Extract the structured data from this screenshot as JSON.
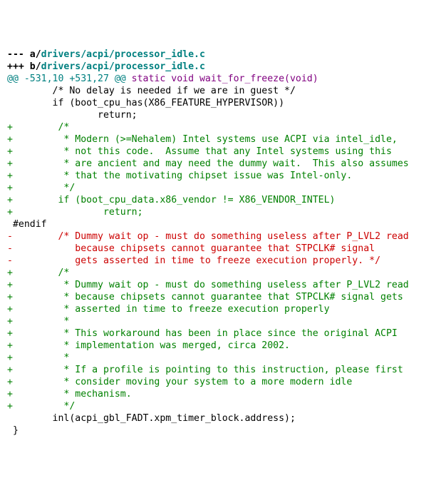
{
  "diff": {
    "file_a_prefix": "--- a/",
    "file_b_prefix": "+++ b/",
    "file_path": "drivers/acpi/processor_idle.c",
    "hunk_header_left": "@@ -531,10 +531,27 @@",
    "hunk_header_right": " static void wait_for_freeze(void)",
    "lines": [
      {
        "type": "ctx",
        "text": "        /* No delay is needed if we are in guest */"
      },
      {
        "type": "ctx",
        "text": "        if (boot_cpu_has(X86_FEATURE_HYPERVISOR))"
      },
      {
        "type": "ctx",
        "text": "                return;"
      },
      {
        "type": "add",
        "text": "+        /*"
      },
      {
        "type": "add",
        "text": "+         * Modern (>=Nehalem) Intel systems use ACPI via intel_idle,"
      },
      {
        "type": "add",
        "text": "+         * not this code.  Assume that any Intel systems using this"
      },
      {
        "type": "add",
        "text": "+         * are ancient and may need the dummy wait.  This also assumes"
      },
      {
        "type": "add",
        "text": "+         * that the motivating chipset issue was Intel-only."
      },
      {
        "type": "add",
        "text": "+         */"
      },
      {
        "type": "add",
        "text": "+        if (boot_cpu_data.x86_vendor != X86_VENDOR_INTEL)"
      },
      {
        "type": "add",
        "text": "+                return;"
      },
      {
        "type": "ctx",
        "text": " #endif"
      },
      {
        "type": "del",
        "text": "-        /* Dummy wait op - must do something useless after P_LVL2 read"
      },
      {
        "type": "del",
        "text": "-           because chipsets cannot guarantee that STPCLK# signal"
      },
      {
        "type": "del",
        "text": "-           gets asserted in time to freeze execution properly. */"
      },
      {
        "type": "add",
        "text": "+        /*"
      },
      {
        "type": "add",
        "text": "+         * Dummy wait op - must do something useless after P_LVL2 read"
      },
      {
        "type": "add",
        "text": "+         * because chipsets cannot guarantee that STPCLK# signal gets"
      },
      {
        "type": "add",
        "text": "+         * asserted in time to freeze execution properly"
      },
      {
        "type": "add",
        "text": "+         *"
      },
      {
        "type": "add",
        "text": "+         * This workaround has been in place since the original ACPI"
      },
      {
        "type": "add",
        "text": "+         * implementation was merged, circa 2002."
      },
      {
        "type": "add",
        "text": "+         *"
      },
      {
        "type": "add",
        "text": "+         * If a profile is pointing to this instruction, please first"
      },
      {
        "type": "add",
        "text": "+         * consider moving your system to a more modern idle"
      },
      {
        "type": "add",
        "text": "+         * mechanism."
      },
      {
        "type": "add",
        "text": "+         */"
      },
      {
        "type": "ctx",
        "text": "        inl(acpi_gbl_FADT.xpm_timer_block.address);"
      },
      {
        "type": "ctx",
        "text": " }"
      }
    ]
  }
}
